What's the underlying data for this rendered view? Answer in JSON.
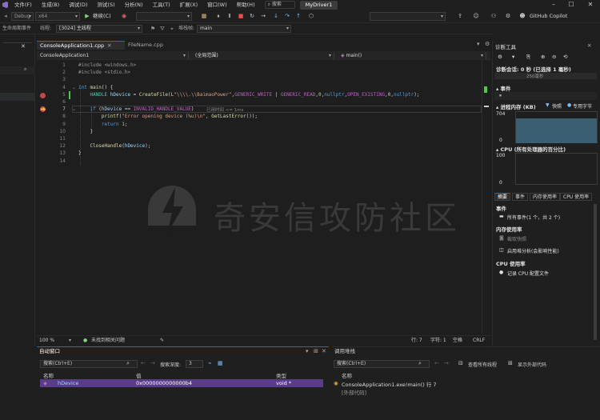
{
  "menu": {
    "items": [
      "文件(F)",
      "生成(B)",
      "调试(D)",
      "测试(S)",
      "分析(N)",
      "工具(T)",
      "扩展(X)",
      "窗口(W)",
      "帮助(H)"
    ],
    "search_label": "搜索",
    "project_name": "MyDriver1"
  },
  "toolbar": {
    "config": "Debug",
    "platform": "x64",
    "continue_label": "继续(C)",
    "copilot_label": "GitHub Copilot"
  },
  "locbar": {
    "process_label": "生命周期事件",
    "thread_label": "线程:",
    "thread_value": "[3024] 主线程",
    "stack_label": "堆栈帧:",
    "stack_value": "main"
  },
  "tabs": [
    {
      "label": "ConsoleApplication1.cpp",
      "active": true
    },
    {
      "label": "FileName.cpp",
      "active": false
    }
  ],
  "navbar": {
    "project": "ConsoleApplication1",
    "scope": "(全局范围)",
    "member": "main()"
  },
  "editor": {
    "lines": [
      {
        "n": "1",
        "code": "#include <windows.h>"
      },
      {
        "n": "2",
        "code": "#include <stdio.h>"
      },
      {
        "n": "3",
        "code": ""
      },
      {
        "n": "4",
        "code": "int main() {"
      },
      {
        "n": "5",
        "code": "    HANDLE hDevice = CreateFile(L\"\\\\\\\\.\\\\BaimaoPower\",GENERIC_WRITE | GENERIC_READ,0,nullptr,OPEN_EXISTING,0,nullptr);"
      },
      {
        "n": "6",
        "code": ""
      },
      {
        "n": "7",
        "code": "    if (hDevice == INVALID_HANDLE_VALUE)"
      },
      {
        "n": "8",
        "code": "        printf(\"Error opening device (%u)\\n\", GetLastError());"
      },
      {
        "n": "9",
        "code": "        return 1;"
      },
      {
        "n": "10",
        "code": "    }"
      },
      {
        "n": "11",
        "code": ""
      },
      {
        "n": "12",
        "code": "    CloseHandle(hDevice);"
      },
      {
        "n": "13",
        "code": "}"
      },
      {
        "n": "14",
        "code": ""
      }
    ],
    "elapsed_hint": "已用时间 <= 1ms"
  },
  "editor_status": {
    "zoom": "100 %",
    "issues": "未找到相关问题",
    "line": "行: 7",
    "char": "字符: 1",
    "space": "空格",
    "eol": "CRLF"
  },
  "diag": {
    "title": "诊断工具",
    "session": "诊断会话: 0 秒 (已选择 1 毫秒)",
    "time_tick": "250毫秒",
    "events_section": "事件",
    "memory_section": "进程内存 (KB)",
    "snapshot_legend": "快照",
    "private_bytes_legend": "专用字节",
    "mem_max": "704",
    "mem_min": "0",
    "cpu_section": "CPU (所有处理器的百分比)",
    "cpu_max": "100",
    "cpu_min": "0",
    "subtabs": [
      "摘要",
      "事件",
      "内存使用率",
      "CPU 使用率"
    ],
    "events_header": "事件",
    "events_all": "所有事件(1 个，共 2 个)",
    "memory_header": "内存使用率",
    "take_snapshot": "截取快照",
    "heap_analysis": "启用堆分析(会影响性能)",
    "cpu_header": "CPU 使用率",
    "record_cpu": "记录 CPU 配置文件"
  },
  "autos": {
    "title": "自动窗口",
    "search_placeholder": "搜索(Ctrl+E)",
    "depth_label": "搜索深度:",
    "depth_value": "3",
    "columns": [
      "名称",
      "值",
      "类型"
    ],
    "rows": [
      {
        "name": "hDevice",
        "value": "0x0000000000000b4",
        "type": "void *"
      }
    ]
  },
  "callstack": {
    "title": "调用堆栈",
    "search_placeholder": "搜索(Ctrl+E)",
    "view_all_threads": "查看所有线程",
    "show_external": "显示外部代码",
    "columns": [
      "名称"
    ],
    "rows": [
      {
        "name": "ConsoleApplication1.exe!main() 行 7"
      },
      {
        "name": "[外部代码]"
      }
    ]
  },
  "watermark": {
    "text": "奇安信攻防社区"
  },
  "colors": {
    "accent": "#0078d4",
    "breakpoint": "#c04a4a",
    "highlight_row": "#5a3d8a",
    "graph_fill": "#3a5f73"
  }
}
